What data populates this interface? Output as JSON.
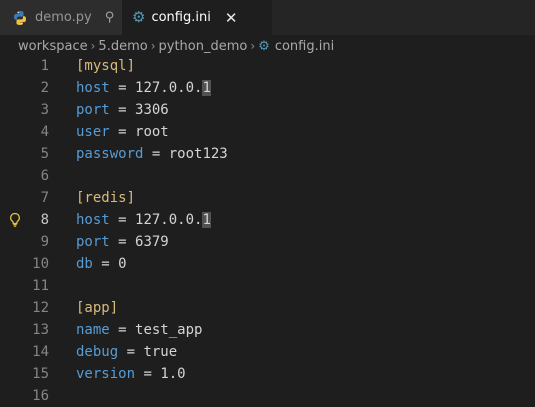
{
  "tabs": [
    {
      "label": "demo.py",
      "icon": "python-icon",
      "state": "inactive",
      "extra_icon": "pin-icon"
    },
    {
      "label": "config.ini",
      "icon": "gear-icon",
      "state": "active",
      "extra_icon": "close-icon"
    }
  ],
  "tab_glyphs": {
    "pin": "⚲",
    "close": "✕",
    "gear": "⚙"
  },
  "breadcrumb": {
    "items": [
      "workspace",
      "5.demo",
      "python_demo",
      "config.ini"
    ],
    "separator": "›"
  },
  "editor": {
    "lines": [
      {
        "n": "1",
        "bracket": "[mysql]"
      },
      {
        "n": "2",
        "key": "host",
        "op": " = ",
        "value": "127.0.0.1"
      },
      {
        "n": "3",
        "key": "port",
        "op": " = ",
        "value": "3306"
      },
      {
        "n": "4",
        "key": "user",
        "op": " = ",
        "value": "root"
      },
      {
        "n": "5",
        "key": "password",
        "op": " = ",
        "value": "root123"
      },
      {
        "n": "6"
      },
      {
        "n": "7",
        "bracket": "[redis]"
      },
      {
        "n": "8",
        "key": "host",
        "op": " = ",
        "value": "127.0.0.1"
      },
      {
        "n": "9",
        "key": "port",
        "op": " = ",
        "value": "6379"
      },
      {
        "n": "10",
        "key": "db",
        "op": " = ",
        "value": "0"
      },
      {
        "n": "11"
      },
      {
        "n": "12",
        "bracket": "[app]"
      },
      {
        "n": "13",
        "key": "name",
        "op": " = ",
        "value": "test_app"
      },
      {
        "n": "14",
        "key": "debug",
        "op": " = ",
        "value": "true"
      },
      {
        "n": "15",
        "key": "version",
        "op": " = ",
        "value": "1.0"
      },
      {
        "n": "16"
      }
    ]
  },
  "colors": {
    "background": "#1e1e1e",
    "section": "#d7ba7d",
    "key": "#569cd6",
    "text": "#d4d4d4",
    "line_number": "#858585",
    "icon_accent": "#519aba"
  }
}
